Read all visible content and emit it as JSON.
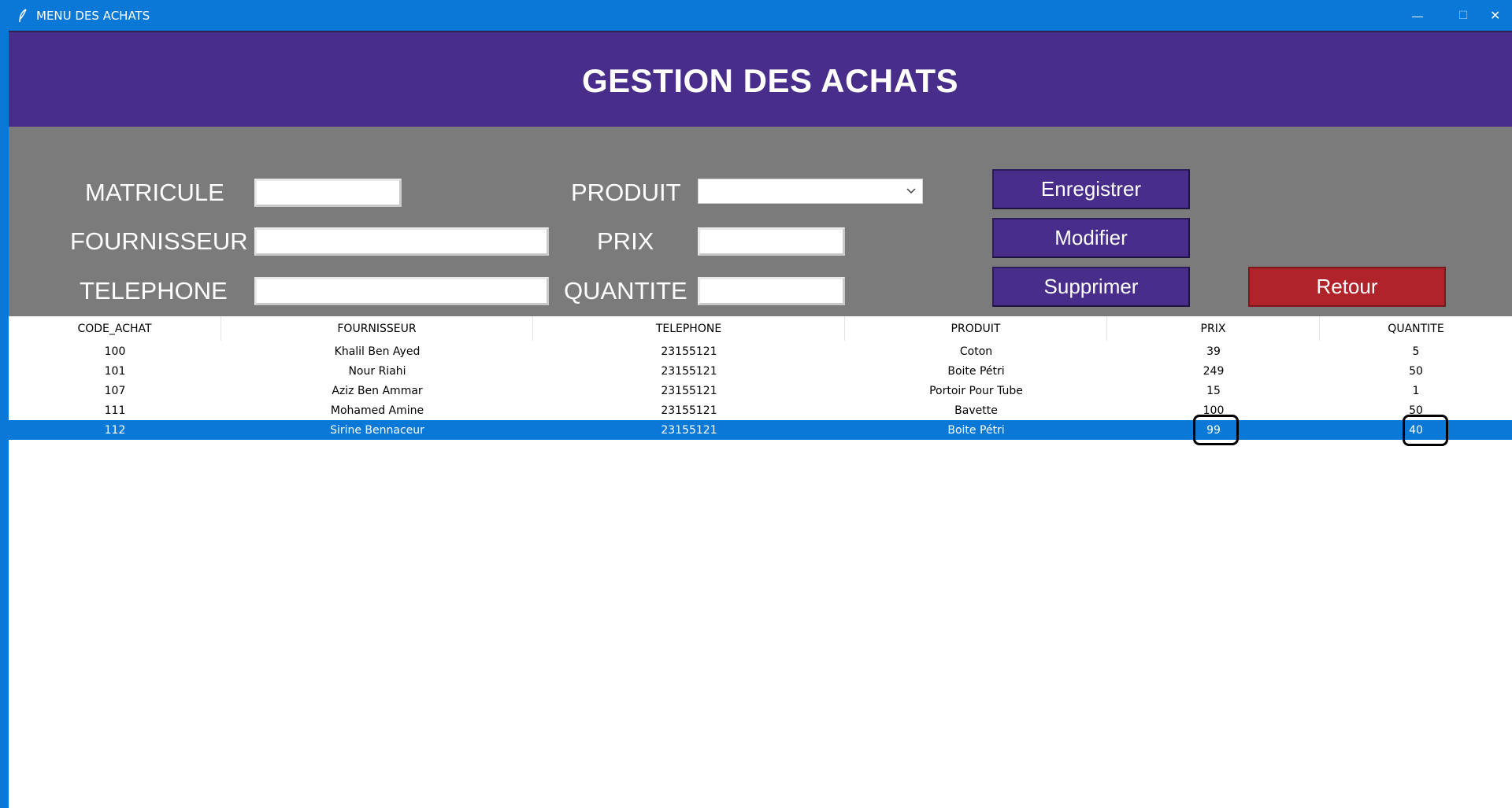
{
  "window": {
    "title": "MENU DES ACHATS",
    "minimize_glyph": "—",
    "maximize_glyph": "☐",
    "close_glyph": "✕"
  },
  "header": {
    "title": "GESTION DES ACHATS"
  },
  "form": {
    "matricule_label": "MATRICULE",
    "matricule_value": "",
    "fournisseur_label": "FOURNISSEUR",
    "fournisseur_value": "",
    "telephone_label": "TELEPHONE",
    "telephone_value": "",
    "produit_label": "PRODUIT",
    "produit_value": "",
    "prix_label": "PRIX",
    "prix_value": "",
    "quantite_label": "QUANTITE",
    "quantite_value": ""
  },
  "buttons": {
    "enregistrer": "Enregistrer",
    "modifier": "Modifier",
    "supprimer": "Supprimer",
    "retour": "Retour"
  },
  "colors": {
    "header_bg": "#482d8a",
    "panel_bg": "#7b7b7b",
    "button_bg": "#482d8a",
    "retour_bg": "#b0232a",
    "selection": "#0a78d7"
  },
  "table": {
    "columns": [
      "CODE_ACHAT",
      "FOURNISSEUR",
      "TELEPHONE",
      "PRODUIT",
      "PRIX",
      "QUANTITE"
    ],
    "rows": [
      [
        "100",
        "Khalil Ben Ayed",
        "23155121",
        "Coton",
        "39",
        "5"
      ],
      [
        "101",
        "Nour Riahi",
        "23155121",
        "Boite Pétri",
        "249",
        "50"
      ],
      [
        "107",
        "Aziz Ben Ammar",
        "23155121",
        "Portoir Pour Tube",
        "15",
        "1"
      ],
      [
        "111",
        "Mohamed Amine",
        "23155121",
        "Bavette",
        "100",
        "50"
      ],
      [
        "112",
        "Sirine Bennaceur",
        "23155121",
        "Boite Pétri",
        "99",
        "40"
      ]
    ],
    "selected_row": 4
  },
  "icons": {
    "app": "feather-icon",
    "combo_arrow": "chevron-down-icon"
  }
}
